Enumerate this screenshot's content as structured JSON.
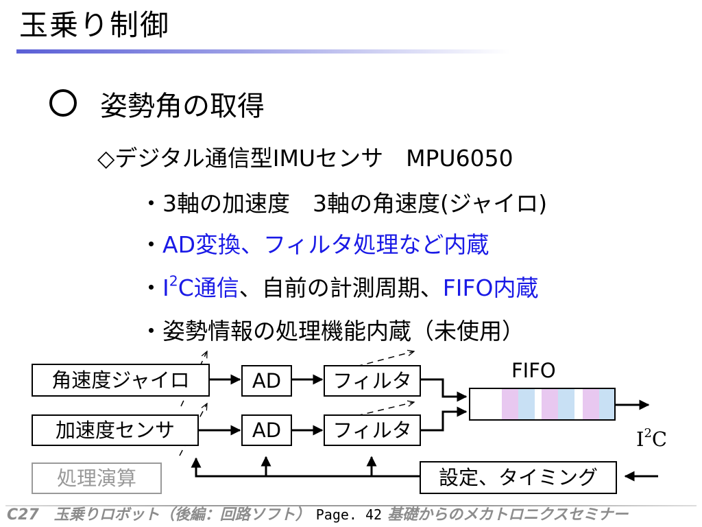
{
  "slide": {
    "title": "玉乗り制御",
    "heading": "姿勢角の取得",
    "subheading": "◇デジタル通信型IMUセンサ　MPU6050",
    "bullets": [
      {
        "parts": [
          "・3軸の加速度　3軸の角速度(ジャイロ)"
        ]
      },
      {
        "parts": [
          "・",
          "AD変換、フィルタ処理など内蔵"
        ]
      },
      {
        "parts": [
          "・",
          "I",
          "2",
          "C通信",
          "、自前の計測周期、",
          "FIFO内蔵"
        ]
      },
      {
        "parts": [
          "・姿勢情報の処理機能内蔵（未使用）"
        ]
      }
    ]
  },
  "diagram": {
    "gyro_label": "角速度ジャイロ",
    "accel_label": "加速度センサ",
    "ad_label": "AD",
    "filter_label": "フィルタ",
    "fifo_label": "FIFO",
    "i2c_base": "I",
    "i2c_sup": "2",
    "i2c_end": "C",
    "settings_label": "設定、タイミング",
    "processing_label": "処理演算",
    "fifo_cells": [
      "#e8c8f0",
      "#c8e0f4",
      "#e8c8f0",
      "#c8e0f4",
      "#e8c8f0",
      "#c8e0f4"
    ]
  },
  "footer": {
    "left": "C27　玉乗りロボット（後編：回路ソフト）",
    "page": "Page. 42",
    "right": "基礎からのメカトロニクスセミナー"
  },
  "colors": {
    "text": "#000000",
    "accent_blue": "#1a1ae6",
    "title_rule": "#5a5fd6",
    "disabled_grey": "#999999",
    "footer_grey": "#8c8c8c"
  }
}
